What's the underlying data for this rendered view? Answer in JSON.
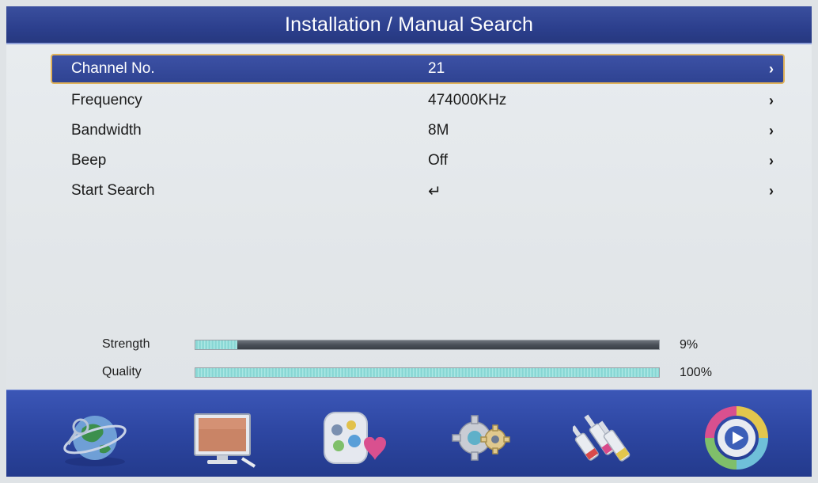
{
  "header": {
    "title": "Installation / Manual Search"
  },
  "menu": {
    "items": [
      {
        "label": "Channel No.",
        "value": "21",
        "selected": true
      },
      {
        "label": "Frequency",
        "value": "474000KHz"
      },
      {
        "label": "Bandwidth",
        "value": "8M"
      },
      {
        "label": "Beep",
        "value": "Off"
      },
      {
        "label": "Start Search",
        "value": "↵"
      }
    ],
    "arrow": "›"
  },
  "signal": {
    "strength": {
      "label": "Strength",
      "percent": 9,
      "text": "9%"
    },
    "quality": {
      "label": "Quality",
      "percent": 100,
      "text": "100%"
    }
  },
  "dock": {
    "icons": [
      "globe-satellite-icon",
      "tv-monitor-icon",
      "media-apps-icon",
      "settings-gear-icon",
      "av-cables-icon",
      "play-media-icon"
    ]
  },
  "colors": {
    "title_bar": "#2c3f8d",
    "selection_border": "#e0b25a",
    "meter_fill": "#9fe3e0"
  }
}
